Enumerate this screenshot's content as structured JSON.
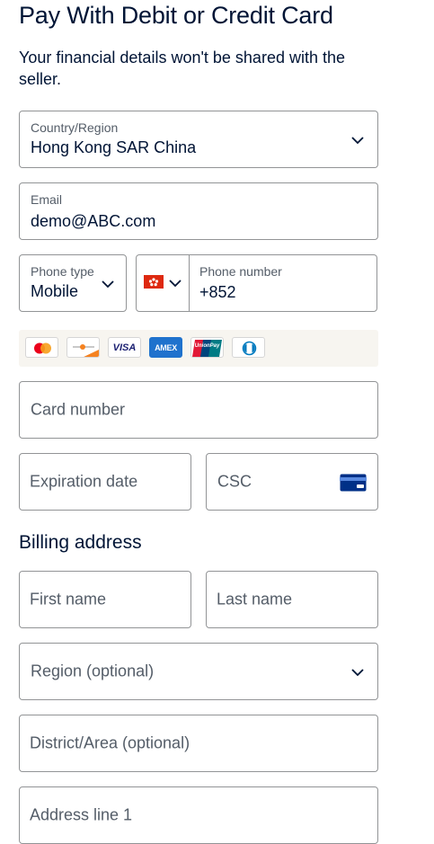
{
  "header": {
    "title": "Pay With Debit or Credit Card",
    "subtitle": "Your financial details won't be shared with the seller."
  },
  "form": {
    "country": {
      "label": "Country/Region",
      "value": "Hong Kong SAR China"
    },
    "email": {
      "label": "Email",
      "value": "demo@ABC.com"
    },
    "phone_type": {
      "label": "Phone type",
      "value": "Mobile"
    },
    "phone_number": {
      "label": "Phone number",
      "value": "+852"
    },
    "card_number": {
      "placeholder": "Card number"
    },
    "expiration": {
      "placeholder": "Expiration date"
    },
    "csc": {
      "placeholder": "CSC"
    }
  },
  "card_brands": {
    "visa_text": "VISA",
    "amex_text": "AMEX",
    "unionpay_text": "UnionPay"
  },
  "billing": {
    "title": "Billing address",
    "first_name": "First name",
    "last_name": "Last name",
    "region": "Region (optional)",
    "district": "District/Area (optional)",
    "address1": "Address line 1"
  },
  "icons": [
    "chevron-down-icon",
    "hong-kong-flag-icon",
    "mastercard-icon",
    "discover-icon",
    "visa-icon",
    "amex-icon",
    "unionpay-icon",
    "diners-icon",
    "csc-card-icon"
  ],
  "colors": {
    "text": "#001435",
    "muted": "#545d68",
    "border": "#929496",
    "strip": "#f7f5f0",
    "accent_blue": "#003087"
  }
}
